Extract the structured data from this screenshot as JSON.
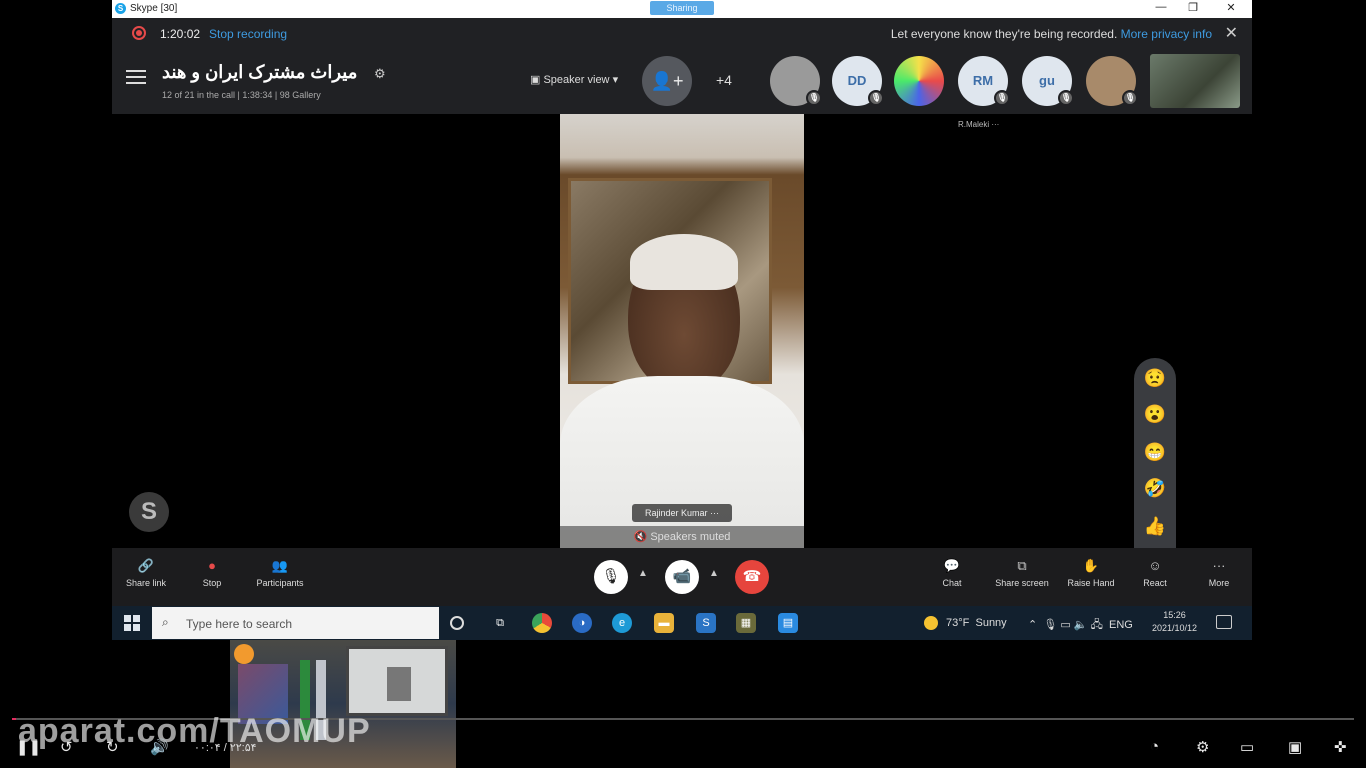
{
  "titlebar": {
    "app_title": "Skype [30]",
    "sharing_label": "Sharing",
    "minimize": "—",
    "maximize": "❐",
    "close": "✕"
  },
  "recording": {
    "time": "1:20:02",
    "stop_label": "Stop recording",
    "notice": "Let everyone know they're being recorded.",
    "privacy_link": "More privacy info"
  },
  "call": {
    "title": "میراث مشترک ایران و هند",
    "subtitle": "12 of 21 in the call | 1:38:34 | 98 Gallery",
    "view_label": "Speaker view",
    "more_count": "+4",
    "participants": [
      {
        "initials": ""
      },
      {
        "initials": "DD"
      },
      {
        "initials": ""
      },
      {
        "initials": "RM"
      },
      {
        "initials": "gu"
      },
      {
        "initials": ""
      }
    ],
    "speaker_label": "R.Maleki"
  },
  "video": {
    "name": "Rajinder Kumar",
    "status": "Speakers muted"
  },
  "controls": {
    "share_link": "Share link",
    "stop": "Stop",
    "participants": "Participants",
    "chat": "Chat",
    "share_screen": "Share screen",
    "raise_hand": "Raise Hand",
    "react": "React",
    "more": "More"
  },
  "reactions": [
    "😟",
    "😮",
    "😁",
    "🤣",
    "👍",
    "❤️"
  ],
  "taskbar": {
    "search_placeholder": "Type here to search",
    "weather_temp": "73°F",
    "weather_text": "Sunny",
    "lang": "ENG",
    "clock_time": "15:26",
    "clock_date": "2021/10/12"
  },
  "player": {
    "watermark": "aparat.com/TAOMUP",
    "time_display": "۰۰:۰۴ / ۲۲:۵۴",
    "progress": 0.003
  },
  "colors": {
    "accent": "#3e9be0",
    "record": "#e64a4a",
    "hangup": "#e6453d",
    "progress": "#e12c5f"
  }
}
